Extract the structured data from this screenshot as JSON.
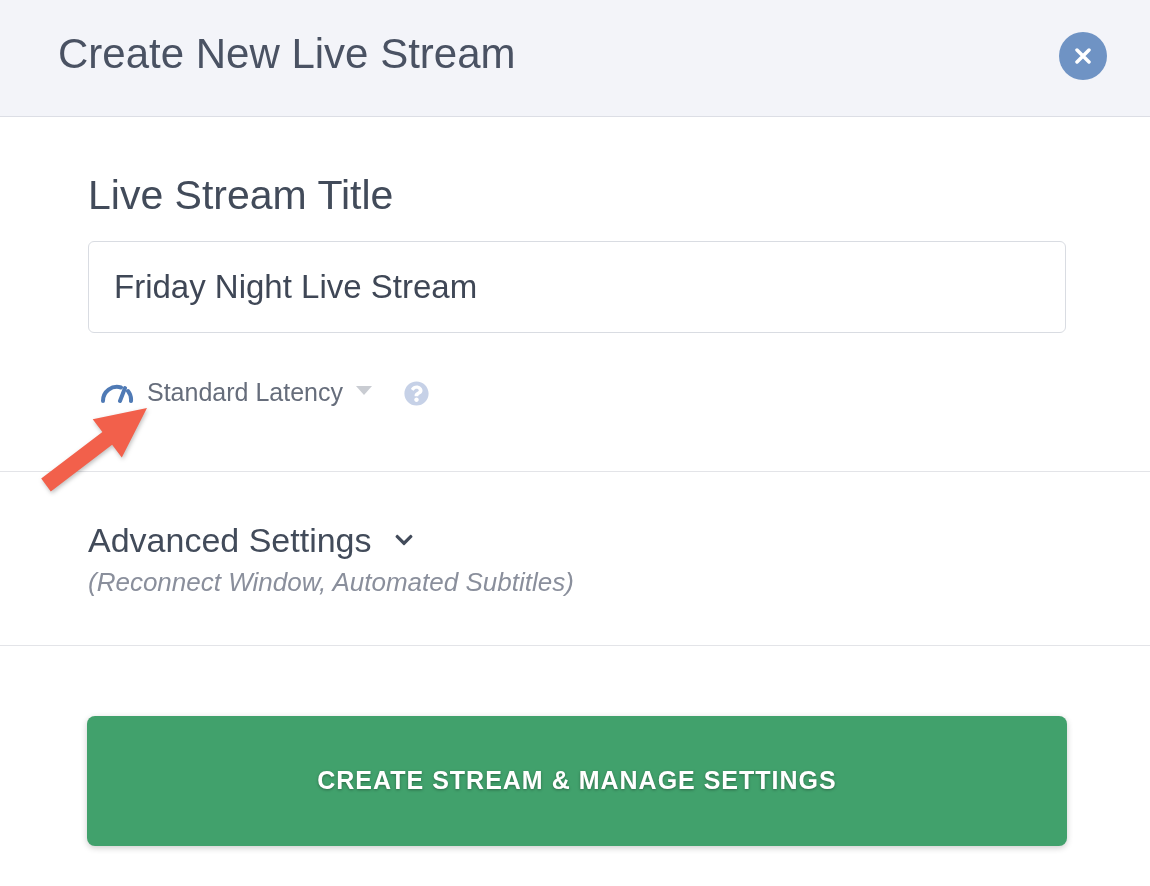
{
  "dialog": {
    "title": "Create New Live Stream"
  },
  "title_field": {
    "label": "Live Stream Title",
    "value": "Friday Night Live Stream"
  },
  "latency_dropdown": {
    "value": "Standard Latency"
  },
  "advanced_settings": {
    "label": "Advanced Settings",
    "expanded": false,
    "description": "(Reconnect Window, Automated Subtitles)"
  },
  "submit_button": {
    "label": "CREATE STREAM & MANAGE SETTINGS"
  }
}
